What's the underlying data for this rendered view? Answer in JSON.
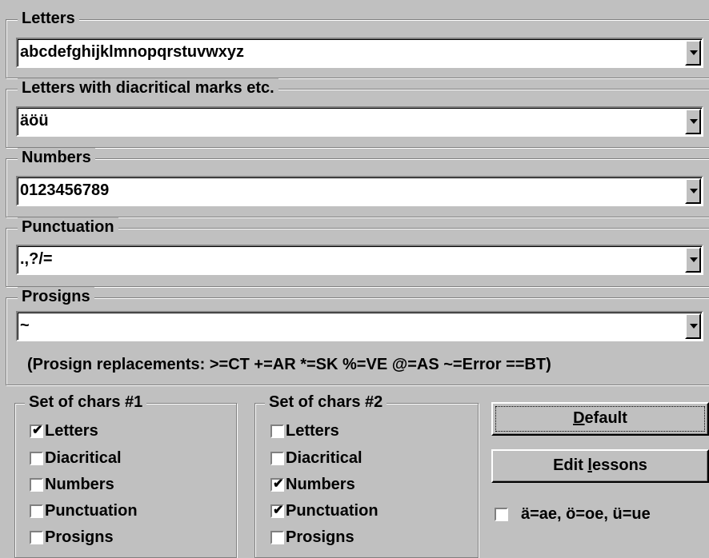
{
  "groups": {
    "letters": {
      "title": "Letters",
      "value": "abcdefghijklmnopqrstuvwxyz"
    },
    "diacritical": {
      "title": "Letters with diacritical marks etc.",
      "value": "äöü"
    },
    "numbers": {
      "title": "Numbers",
      "value": "0123456789"
    },
    "punctuation": {
      "title": "Punctuation",
      "value": ".,?/="
    },
    "prosigns": {
      "title": "Prosigns",
      "value": "~"
    }
  },
  "prosign_note": "(Prosign replacements: >=CT +=AR *=SK %=VE @=AS ~=Error ==BT)",
  "set1": {
    "title": "Set of chars #1",
    "items": [
      {
        "label": "Letters",
        "checked": "✔"
      },
      {
        "label": "Diacritical",
        "checked": ""
      },
      {
        "label": "Numbers",
        "checked": ""
      },
      {
        "label": "Punctuation",
        "checked": ""
      },
      {
        "label": "Prosigns",
        "checked": ""
      }
    ]
  },
  "set2": {
    "title": "Set of chars #2",
    "items": [
      {
        "label": "Letters",
        "checked": ""
      },
      {
        "label": "Diacritical",
        "checked": ""
      },
      {
        "label": "Numbers",
        "checked": "✔"
      },
      {
        "label": "Punctuation",
        "checked": "✔"
      },
      {
        "label": "Prosigns",
        "checked": ""
      }
    ]
  },
  "buttons": {
    "default_mnemonic": "D",
    "default_rest": "efault",
    "edit_pre": "Edit ",
    "edit_mnemonic": "l",
    "edit_rest": "essons"
  },
  "umlaut_option": {
    "label": "ä=ae, ö=oe, ü=ue",
    "checked": ""
  }
}
